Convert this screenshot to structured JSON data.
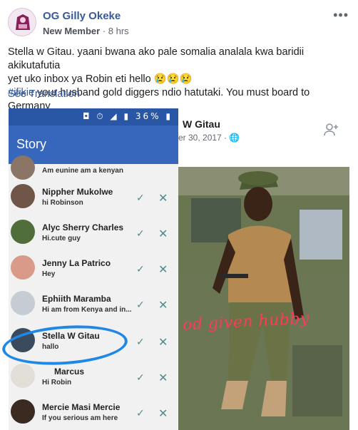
{
  "post": {
    "author": "OG Gilly Okeke",
    "badge": "New Member",
    "time": "8 hrs",
    "more": "•••",
    "text_line1": "Stella w Gitau. yaani bwana ako pale somalia analala kwa baridii akikutafutia",
    "text_line2": "yet uko inbox ya Robin eti hello 😢😢😢",
    "hashtag": "#ifikie",
    "text_line3": " your husband gold diggers ndio hatutaki. You must board to Germany",
    "see_translation": "See Translation"
  },
  "screenshot_left": {
    "status_icons": "◘ ⏱ ◢ ▮ 36% ▮",
    "status_percent": "36%",
    "title": "Story",
    "rows": [
      {
        "name": "",
        "msg": "Am eunine am a kenyan"
      },
      {
        "name": "Nippher Mukolwe",
        "msg": "hi Robinson"
      },
      {
        "name": "Alyc Sherry Charles",
        "msg": "Hi.cute guy"
      },
      {
        "name": "Jenny La Patrico",
        "msg": "Hey"
      },
      {
        "name": "Ephiith Maramba",
        "msg": "Hi am from Kenya and in..."
      },
      {
        "name": "Stella W Gitau",
        "msg": "hallo"
      },
      {
        "name": "Marcus",
        "msg": "Hi Robin"
      },
      {
        "name": "Mercie Masi Mercie",
        "msg": "If you serious am here"
      }
    ],
    "check": "✓",
    "x": "✕"
  },
  "screenshot_right": {
    "name": "W Gitau",
    "date": "er 30, 2017 · 🌐",
    "caption": "od given hubby"
  }
}
